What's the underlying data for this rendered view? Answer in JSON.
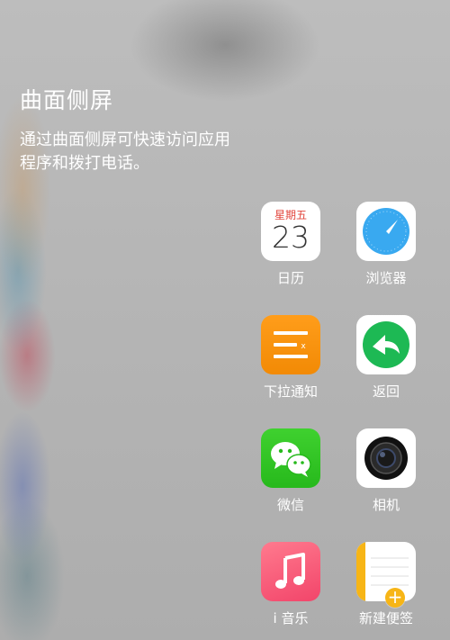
{
  "page": {
    "title": "曲面侧屏",
    "description": "通过曲面侧屏可快速访问应用程序和拨打电话。"
  },
  "apps": [
    {
      "id": "calendar",
      "label": "日历",
      "icon": "calendar-icon",
      "weekday": "星期五",
      "day": "23"
    },
    {
      "id": "browser",
      "label": "浏览器",
      "icon": "compass-icon"
    },
    {
      "id": "notify",
      "label": "下拉通知",
      "icon": "notification-list-icon"
    },
    {
      "id": "back",
      "label": "返回",
      "icon": "back-arrow-icon"
    },
    {
      "id": "wechat",
      "label": "微信",
      "icon": "wechat-icon"
    },
    {
      "id": "camera",
      "label": "相机",
      "icon": "camera-icon"
    },
    {
      "id": "music",
      "label": "i 音乐",
      "icon": "music-note-icon"
    },
    {
      "id": "notes",
      "label": "新建便签",
      "icon": "notes-icon",
      "badge": "+"
    }
  ],
  "colors": {
    "calendar_red": "#e2453c",
    "browser_blue": "#39a9f0",
    "notify_orange": "#f6900c",
    "back_green": "#1db954",
    "wechat_green": "#2fc421",
    "music_pink": "#f5506f",
    "notes_yellow": "#f7b516"
  }
}
